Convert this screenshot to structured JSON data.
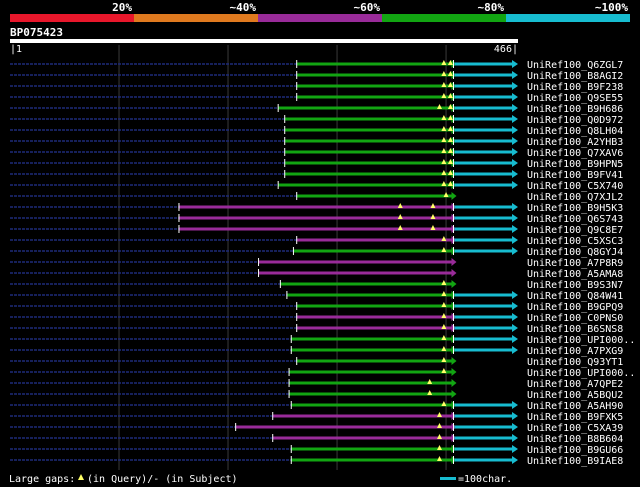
{
  "scale": {
    "labels": [
      "20%",
      "~40%",
      "~60%",
      "~80%",
      "~100%"
    ],
    "colors": [
      "#e8172b",
      "#e07a1f",
      "#992b99",
      "#12a512",
      "#17bcd0"
    ]
  },
  "query": {
    "id": "BP075423",
    "start_label": "|1",
    "end_label": "466|",
    "length": 466
  },
  "hits": [
    {
      "name": "UniRef100_Q6ZGL7",
      "color": "#12a512",
      "start": 263,
      "end": 405,
      "ext": true,
      "marks": [
        398,
        404
      ]
    },
    {
      "name": "UniRef100_B8AGI2",
      "color": "#12a512",
      "start": 263,
      "end": 405,
      "ext": true,
      "marks": [
        398,
        404
      ]
    },
    {
      "name": "UniRef100_B9F238",
      "color": "#12a512",
      "start": 263,
      "end": 405,
      "ext": true,
      "marks": [
        398,
        404
      ]
    },
    {
      "name": "UniRef100_Q9SE55",
      "color": "#12a512",
      "start": 263,
      "end": 405,
      "ext": true,
      "marks": [
        398,
        404
      ]
    },
    {
      "name": "UniRef100_B9H686",
      "color": "#12a512",
      "start": 246,
      "end": 405,
      "ext": true,
      "marks": [
        394,
        404
      ]
    },
    {
      "name": "UniRef100_Q0D972",
      "color": "#12a512",
      "start": 252,
      "end": 405,
      "ext": true,
      "marks": [
        398,
        404
      ]
    },
    {
      "name": "UniRef100_Q8LH04",
      "color": "#12a512",
      "start": 252,
      "end": 405,
      "ext": true,
      "marks": [
        398,
        404
      ]
    },
    {
      "name": "UniRef100_A2YHB3",
      "color": "#12a512",
      "start": 252,
      "end": 405,
      "ext": true,
      "marks": [
        398,
        404
      ]
    },
    {
      "name": "UniRef100_Q7XAV6",
      "color": "#12a512",
      "start": 252,
      "end": 405,
      "ext": true,
      "marks": [
        398,
        404
      ]
    },
    {
      "name": "UniRef100_B9HPN5",
      "color": "#12a512",
      "start": 252,
      "end": 405,
      "ext": true,
      "marks": [
        398,
        404
      ]
    },
    {
      "name": "UniRef100_B9FV41",
      "color": "#12a512",
      "start": 252,
      "end": 405,
      "ext": true,
      "marks": [
        398,
        404
      ]
    },
    {
      "name": "UniRef100_C5X740",
      "color": "#12a512",
      "start": 246,
      "end": 405,
      "ext": true,
      "marks": [
        398,
        404
      ]
    },
    {
      "name": "UniRef100_Q7XJL2",
      "color": "#12a512",
      "start": 263,
      "end": 405,
      "ext": false,
      "marks": [
        400
      ]
    },
    {
      "name": "UniRef100_B9H5K3",
      "color": "#992b99",
      "start": 155,
      "end": 405,
      "ext": true,
      "marks": [
        358,
        388
      ]
    },
    {
      "name": "UniRef100_Q6S743",
      "color": "#992b99",
      "start": 155,
      "end": 405,
      "ext": true,
      "marks": [
        358,
        388
      ]
    },
    {
      "name": "UniRef100_Q9C8E7",
      "color": "#992b99",
      "start": 155,
      "end": 405,
      "ext": true,
      "marks": [
        358,
        388
      ]
    },
    {
      "name": "UniRef100_C5XSC3",
      "color": "#992b99",
      "start": 263,
      "end": 405,
      "ext": true,
      "marks": [
        398
      ]
    },
    {
      "name": "UniRef100_Q8GYJ4",
      "color": "#12a512",
      "start": 260,
      "end": 405,
      "ext": true,
      "marks": [
        398
      ]
    },
    {
      "name": "UniRef100_A7P8R9",
      "color": "#992b99",
      "start": 228,
      "end": 405,
      "ext": false,
      "marks": []
    },
    {
      "name": "UniRef100_A5AMA8",
      "color": "#992b99",
      "start": 228,
      "end": 405,
      "ext": false,
      "marks": []
    },
    {
      "name": "UniRef100_B9S3N7",
      "color": "#12a512",
      "start": 248,
      "end": 405,
      "ext": false,
      "marks": [
        398
      ]
    },
    {
      "name": "UniRef100_Q84W41",
      "color": "#12a512",
      "start": 254,
      "end": 405,
      "ext": true,
      "marks": [
        398
      ]
    },
    {
      "name": "UniRef100_B9GPQ9",
      "color": "#12a512",
      "start": 263,
      "end": 405,
      "ext": true,
      "marks": [
        398
      ]
    },
    {
      "name": "UniRef100_C0PNS0",
      "color": "#992b99",
      "start": 263,
      "end": 405,
      "ext": true,
      "marks": [
        398
      ]
    },
    {
      "name": "UniRef100_B6SNS8",
      "color": "#992b99",
      "start": 263,
      "end": 405,
      "ext": true,
      "marks": [
        398
      ]
    },
    {
      "name": "UniRef100_UPI000..",
      "color": "#12a512",
      "start": 258,
      "end": 405,
      "ext": true,
      "marks": [
        398
      ]
    },
    {
      "name": "UniRef100_A7PXG9",
      "color": "#12a512",
      "start": 258,
      "end": 405,
      "ext": true,
      "marks": [
        398
      ]
    },
    {
      "name": "UniRef100_Q93YT1",
      "color": "#12a512",
      "start": 263,
      "end": 405,
      "ext": false,
      "marks": [
        398
      ]
    },
    {
      "name": "UniRef100_UPI000..",
      "color": "#12a512",
      "start": 256,
      "end": 405,
      "ext": false,
      "marks": [
        398
      ]
    },
    {
      "name": "UniRef100_A7QPE2",
      "color": "#12a512",
      "start": 256,
      "end": 405,
      "ext": false,
      "marks": [
        385
      ]
    },
    {
      "name": "UniRef100_A5BQU2",
      "color": "#12a512",
      "start": 256,
      "end": 405,
      "ext": false,
      "marks": [
        385
      ]
    },
    {
      "name": "UniRef100_A5AH90",
      "color": "#12a512",
      "start": 258,
      "end": 405,
      "ext": true,
      "marks": [
        398
      ]
    },
    {
      "name": "UniRef100_B9FXK5",
      "color": "#992b99",
      "start": 241,
      "end": 405,
      "ext": true,
      "marks": [
        394
      ]
    },
    {
      "name": "UniRef100_C5XA39",
      "color": "#992b99",
      "start": 207,
      "end": 405,
      "ext": true,
      "marks": [
        394
      ]
    },
    {
      "name": "UniRef100_B8B604",
      "color": "#992b99",
      "start": 241,
      "end": 405,
      "ext": true,
      "marks": [
        394
      ]
    },
    {
      "name": "UniRef100_B9GU66",
      "color": "#12a512",
      "start": 258,
      "end": 405,
      "ext": true,
      "marks": [
        394
      ]
    },
    {
      "name": "UniRef100_B9IAE8",
      "color": "#12a512",
      "start": 258,
      "end": 405,
      "ext": true,
      "marks": [
        394
      ]
    }
  ],
  "legend": {
    "prefix": "Large gaps: ",
    "in_query": "(in Query)/-",
    "in_subject": " (in Subject)",
    "scale_label": "=100char.",
    "scale_color": "#17bcd0"
  }
}
